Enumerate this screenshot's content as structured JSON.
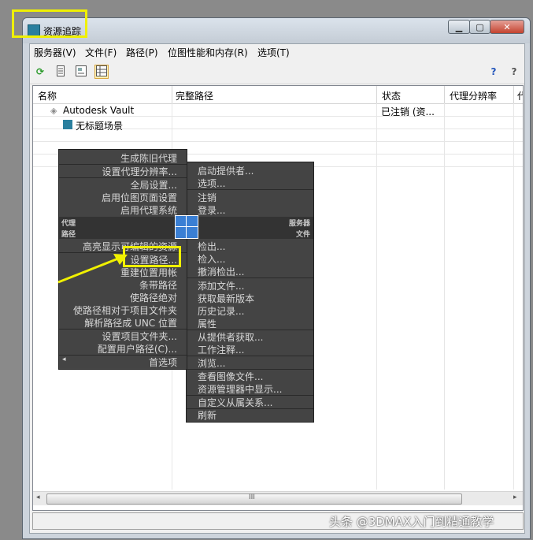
{
  "window": {
    "title": "资源追踪",
    "min_glyph": "▁",
    "max_glyph": "▢",
    "close_glyph": "✕"
  },
  "menubar": [
    "服务器(V)",
    "文件(F)",
    "路径(P)",
    "位图性能和内存(R)",
    "选项(T)"
  ],
  "toolbar": {
    "help1": "?",
    "help2": "?"
  },
  "columns": [
    "名称",
    "完整路径",
    "状态",
    "代理分辨率",
    "代"
  ],
  "rows": [
    {
      "name": "Autodesk Vault",
      "status": "已注销 (资..."
    },
    {
      "name": "无标题场景",
      "status": ""
    }
  ],
  "left_menu": {
    "items_top": [
      "生成陈旧代理",
      "设置代理分辨率...",
      "全局设置...",
      "启用位图页面设置",
      "启用代理系统"
    ],
    "section_proxy": "代理",
    "section_path": "路径",
    "items_path": [
      "高亮显示可编辑的资源",
      "设置路径...",
      "重建位置用帐",
      "条带路径",
      "使路径绝对",
      "使路径相对于项目文件夹",
      "解析路径成 UNC 位置",
      "设置项目文件夹...",
      "配置用户路径(C)...",
      "首选项"
    ]
  },
  "right_menu": {
    "items_provider": [
      "启动提供者...",
      "选项...",
      "注销",
      "登录..."
    ],
    "section_server": "服务器",
    "section_file": "文件",
    "items_file": [
      "检出...",
      "检入...",
      "撤消检出...",
      "添加文件...",
      "获取最新版本",
      "历史记录...",
      "属性",
      "从提供者获取...",
      "工作注释...",
      "浏览...",
      "查看图像文件...",
      "资源管理器中显示...",
      "自定义从属关系...",
      "刷新"
    ]
  },
  "scroll": {
    "grip": "III"
  },
  "watermark": "头条 @3DMAX入门到精通教学",
  "colors": {
    "highlight": "#f0f000",
    "menu_bg": "#444444",
    "quad": "#3a7fd4"
  }
}
